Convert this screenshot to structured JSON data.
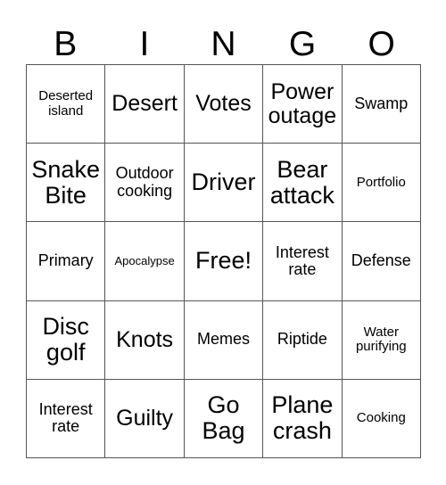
{
  "card": {
    "title": "BINGO Card",
    "header_letters": [
      "B",
      "I",
      "N",
      "G",
      "O"
    ],
    "border_color": "#555555",
    "text_color": "#000000",
    "background_color": "#ffffff",
    "rows": 5,
    "columns": 5,
    "cells": [
      [
        {
          "label": "Deserted island",
          "size": "sm"
        },
        {
          "label": "Desert",
          "size": "xl"
        },
        {
          "label": "Votes",
          "size": "xl"
        },
        {
          "label": "Power outage",
          "size": "xl"
        },
        {
          "label": "Swamp",
          "size": "md"
        }
      ],
      [
        {
          "label": "Snake Bite",
          "size": "xxl"
        },
        {
          "label": "Outdoor cooking",
          "size": "md"
        },
        {
          "label": "Driver",
          "size": "xxl"
        },
        {
          "label": "Bear attack",
          "size": "xxl"
        },
        {
          "label": "Portfolio",
          "size": "sm"
        }
      ],
      [
        {
          "label": "Primary",
          "size": "md"
        },
        {
          "label": "Apocalypse",
          "size": "xs"
        },
        {
          "label": "Free!",
          "size": "xxl"
        },
        {
          "label": "Interest rate",
          "size": "md"
        },
        {
          "label": "Defense",
          "size": "md"
        }
      ],
      [
        {
          "label": "Disc golf",
          "size": "xxl"
        },
        {
          "label": "Knots",
          "size": "xl"
        },
        {
          "label": "Memes",
          "size": "md"
        },
        {
          "label": "Riptide",
          "size": "md"
        },
        {
          "label": "Water purifying",
          "size": "sm"
        }
      ],
      [
        {
          "label": "Interest rate",
          "size": "md"
        },
        {
          "label": "Guilty",
          "size": "xl"
        },
        {
          "label": "Go Bag",
          "size": "xxl"
        },
        {
          "label": "Plane crash",
          "size": "xxl"
        },
        {
          "label": "Cooking",
          "size": "sm"
        }
      ]
    ]
  }
}
